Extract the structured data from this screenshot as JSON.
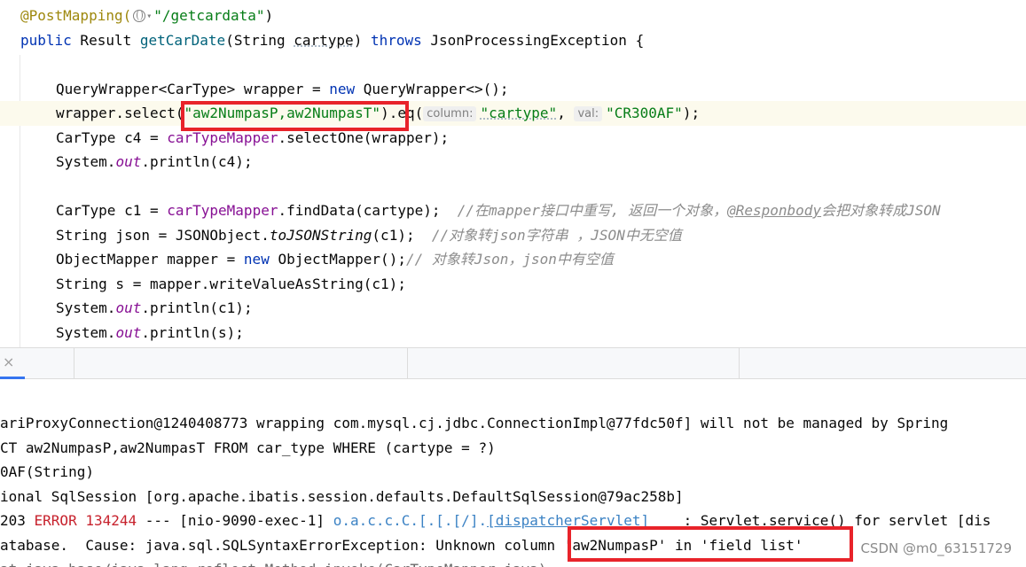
{
  "editor": {
    "l1": {
      "ann": "@PostMapping(",
      "str": "\"/getcardata\"",
      "end": ")"
    },
    "l2": {
      "kw1": "public",
      "t1": " Result ",
      "fn": "getCarDate",
      "t2": "(String ",
      "param": "cartype",
      "t3": ") ",
      "kw2": "throws",
      "t4": " JsonProcessingException {"
    },
    "l4": {
      "t1": "QueryWrapper<CarType> wrapper = ",
      "kw": "new",
      "t2": " QueryWrapper<>();"
    },
    "l5": {
      "t1": "wrapper.select(",
      "s1": "\"aw2NumpasP,aw2NumpasT\"",
      "t2": ").eq(",
      "h1": "column:",
      "s2": "\"cartype\"",
      "t3": ", ",
      "h2": "val:",
      "s3": "\"CR300AF\"",
      "t4": ");"
    },
    "l6": {
      "t1": "CarType c4 = ",
      "fld": "carTypeMapper",
      "t2": ".selectOne(wrapper);"
    },
    "l7": {
      "t1": "System.",
      "fld": "out",
      "t2": ".println(c4);"
    },
    "l9": {
      "t1": "CarType c1 = ",
      "fld": "carTypeMapper",
      "t2": ".findData(cartype);  ",
      "c1": "//在mapper接口中重写, 返回一个对象，",
      "c2": "@Responbody",
      "c3": "会把对象转成JSON"
    },
    "l10": {
      "t1": "String json = JSONObject.",
      "sfn": "toJSONString",
      "t2": "(c1);  ",
      "cm": "//对象转json字符串 ，JSON中无空值"
    },
    "l11": {
      "t1": "ObjectMapper mapper = ",
      "kw": "new",
      "t2": " ObjectMapper();",
      "cm": "// 对象转Json，json中有空值"
    },
    "l12": {
      "t1": "String s = mapper.writeValueAsString(c1);"
    },
    "l13": {
      "t1": "System.",
      "fld": "out",
      "t2": ".println(c1);"
    },
    "l14": {
      "t1": "System.",
      "fld": "out",
      "t2": ".println(s);"
    }
  },
  "toolbar": {
    "close": "×"
  },
  "console": {
    "c1": "ariProxyConnection@1240408773 wrapping com.mysql.cj.jdbc.ConnectionImpl@77fdc50f] will not be managed by Spring",
    "c2": "CT aw2NumpasP,aw2NumpasT FROM car_type WHERE (cartype = ?)",
    "c3": "0AF(String)",
    "c4": "ional SqlSession [org.apache.ibatis.session.defaults.DefaultSqlSession@79ac258b]",
    "c5": {
      "num": "203 ",
      "level": "ERROR 134244",
      "t1": " --- [nio-9090-exec-1] ",
      "cls": "o.a.c.c.C.[.[.[/].",
      "link": "[dispatcherServlet]",
      "t2": "    : Servlet.service() for servlet [dis"
    },
    "c6": {
      "t1": "atabase.  Cause: java.sql.SQLSyntaxErrorException: Unknown column ",
      "t2": "'aw2NumpasP' in 'field list'"
    },
    "c7": "at java.base/java.lang.reflect.Method.invoke(CarTypeMapper.java)"
  },
  "watermark": "CSDN @m0_63151729",
  "colors": {
    "annotation_box": "#e8232a",
    "keyword": "#0033b3",
    "string": "#067d17",
    "error": "#c7222d"
  }
}
